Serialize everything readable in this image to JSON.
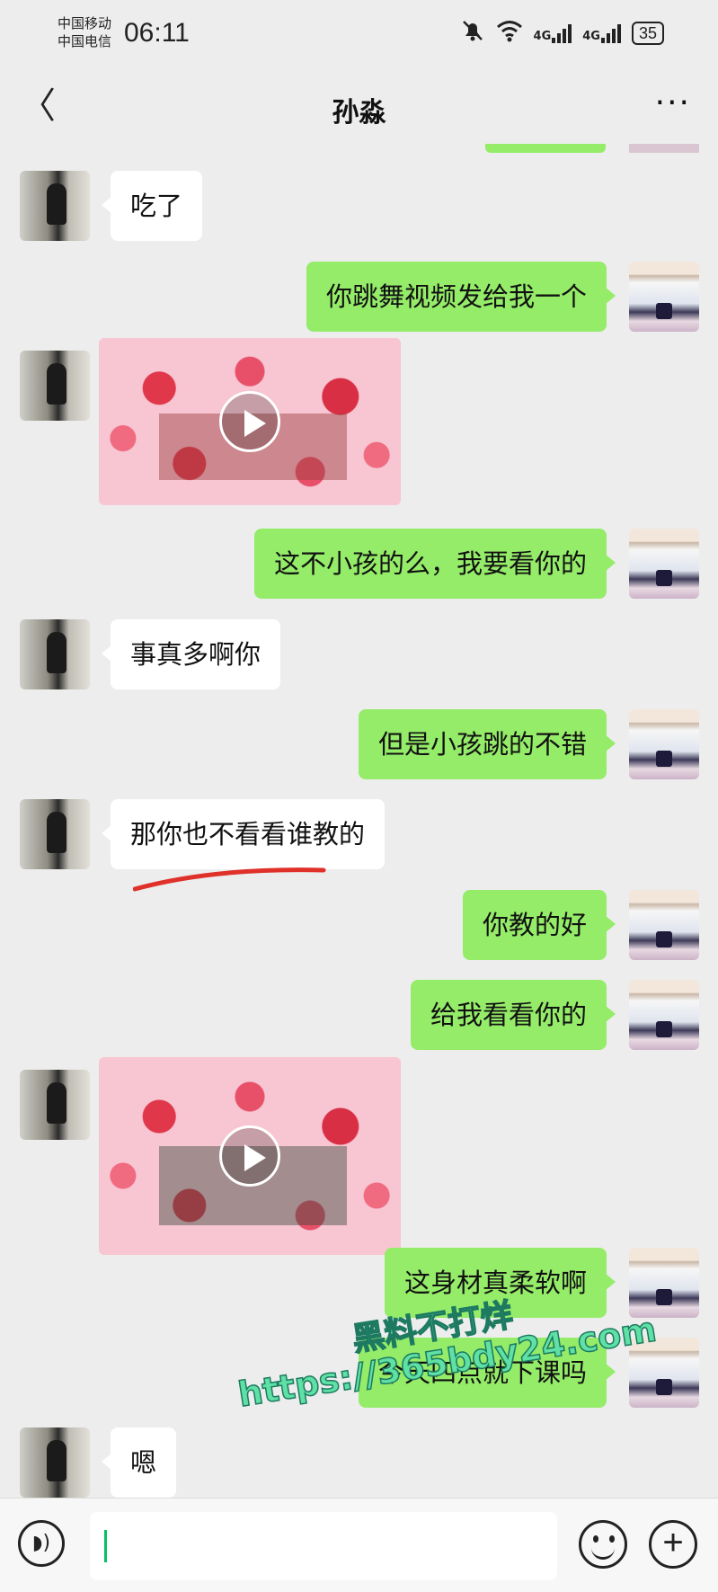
{
  "status_bar": {
    "carrier_1": "中国移动",
    "carrier_2": "中国电信",
    "time": "06:11",
    "network_1": "4G",
    "network_2": "4G",
    "battery": "35",
    "icons": [
      "mute-bell-icon",
      "wifi-icon",
      "signal-icon",
      "signal-icon",
      "battery-icon"
    ]
  },
  "header": {
    "back_symbol": "〈",
    "title": "孙淼",
    "more_symbol": "···"
  },
  "messages": [
    {
      "side": "in",
      "type": "text",
      "text": "吃了"
    },
    {
      "side": "out",
      "type": "text",
      "text": "你跳舞视频发给我一个"
    },
    {
      "side": "in",
      "type": "video"
    },
    {
      "side": "out",
      "type": "text",
      "text": "这不小孩的么，我要看你的"
    },
    {
      "side": "in",
      "type": "text",
      "text": "事真多啊你"
    },
    {
      "side": "out",
      "type": "text",
      "text": "但是小孩跳的不错"
    },
    {
      "side": "in",
      "type": "text",
      "text": "那你也不看看谁教的"
    },
    {
      "side": "out",
      "type": "text",
      "text": "你教的好"
    },
    {
      "side": "out",
      "type": "text",
      "text": "给我看看你的"
    },
    {
      "side": "in",
      "type": "video"
    },
    {
      "side": "out",
      "type": "text",
      "text": "这身材真柔软啊"
    },
    {
      "side": "out",
      "type": "text",
      "text": "今天四点就下课吗"
    },
    {
      "side": "in",
      "type": "text",
      "text": "嗯"
    }
  ],
  "watermark": {
    "line_1": "黑料不打烊",
    "line_2": "https://365bdy24.com"
  },
  "input_bar": {
    "voice_symbol": "◗)",
    "plus_symbol": "+",
    "placeholder": ""
  },
  "colors": {
    "background": "#ededed",
    "outgoing_bubble": "#95ec69",
    "incoming_bubble": "#ffffff",
    "annotation_line": "#e0302a",
    "watermark": "#5fe0a4"
  }
}
